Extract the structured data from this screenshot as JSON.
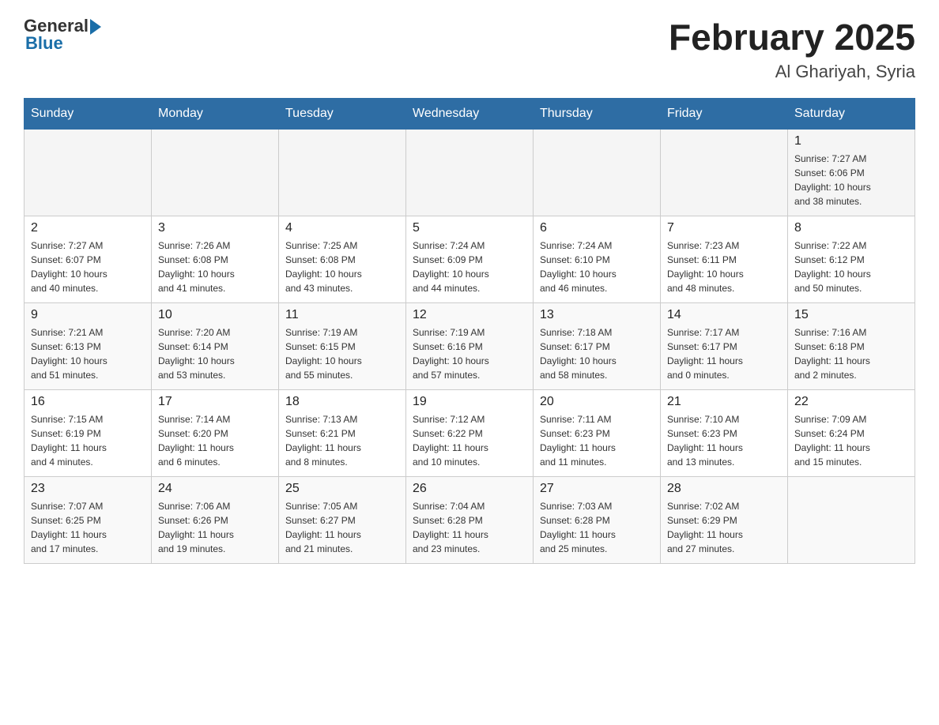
{
  "header": {
    "logo_general": "General",
    "logo_blue": "Blue",
    "title": "February 2025",
    "subtitle": "Al Ghariyah, Syria"
  },
  "weekdays": [
    "Sunday",
    "Monday",
    "Tuesday",
    "Wednesday",
    "Thursday",
    "Friday",
    "Saturday"
  ],
  "weeks": [
    [
      {
        "day": "",
        "info": ""
      },
      {
        "day": "",
        "info": ""
      },
      {
        "day": "",
        "info": ""
      },
      {
        "day": "",
        "info": ""
      },
      {
        "day": "",
        "info": ""
      },
      {
        "day": "",
        "info": ""
      },
      {
        "day": "1",
        "info": "Sunrise: 7:27 AM\nSunset: 6:06 PM\nDaylight: 10 hours\nand 38 minutes."
      }
    ],
    [
      {
        "day": "2",
        "info": "Sunrise: 7:27 AM\nSunset: 6:07 PM\nDaylight: 10 hours\nand 40 minutes."
      },
      {
        "day": "3",
        "info": "Sunrise: 7:26 AM\nSunset: 6:08 PM\nDaylight: 10 hours\nand 41 minutes."
      },
      {
        "day": "4",
        "info": "Sunrise: 7:25 AM\nSunset: 6:08 PM\nDaylight: 10 hours\nand 43 minutes."
      },
      {
        "day": "5",
        "info": "Sunrise: 7:24 AM\nSunset: 6:09 PM\nDaylight: 10 hours\nand 44 minutes."
      },
      {
        "day": "6",
        "info": "Sunrise: 7:24 AM\nSunset: 6:10 PM\nDaylight: 10 hours\nand 46 minutes."
      },
      {
        "day": "7",
        "info": "Sunrise: 7:23 AM\nSunset: 6:11 PM\nDaylight: 10 hours\nand 48 minutes."
      },
      {
        "day": "8",
        "info": "Sunrise: 7:22 AM\nSunset: 6:12 PM\nDaylight: 10 hours\nand 50 minutes."
      }
    ],
    [
      {
        "day": "9",
        "info": "Sunrise: 7:21 AM\nSunset: 6:13 PM\nDaylight: 10 hours\nand 51 minutes."
      },
      {
        "day": "10",
        "info": "Sunrise: 7:20 AM\nSunset: 6:14 PM\nDaylight: 10 hours\nand 53 minutes."
      },
      {
        "day": "11",
        "info": "Sunrise: 7:19 AM\nSunset: 6:15 PM\nDaylight: 10 hours\nand 55 minutes."
      },
      {
        "day": "12",
        "info": "Sunrise: 7:19 AM\nSunset: 6:16 PM\nDaylight: 10 hours\nand 57 minutes."
      },
      {
        "day": "13",
        "info": "Sunrise: 7:18 AM\nSunset: 6:17 PM\nDaylight: 10 hours\nand 58 minutes."
      },
      {
        "day": "14",
        "info": "Sunrise: 7:17 AM\nSunset: 6:17 PM\nDaylight: 11 hours\nand 0 minutes."
      },
      {
        "day": "15",
        "info": "Sunrise: 7:16 AM\nSunset: 6:18 PM\nDaylight: 11 hours\nand 2 minutes."
      }
    ],
    [
      {
        "day": "16",
        "info": "Sunrise: 7:15 AM\nSunset: 6:19 PM\nDaylight: 11 hours\nand 4 minutes."
      },
      {
        "day": "17",
        "info": "Sunrise: 7:14 AM\nSunset: 6:20 PM\nDaylight: 11 hours\nand 6 minutes."
      },
      {
        "day": "18",
        "info": "Sunrise: 7:13 AM\nSunset: 6:21 PM\nDaylight: 11 hours\nand 8 minutes."
      },
      {
        "day": "19",
        "info": "Sunrise: 7:12 AM\nSunset: 6:22 PM\nDaylight: 11 hours\nand 10 minutes."
      },
      {
        "day": "20",
        "info": "Sunrise: 7:11 AM\nSunset: 6:23 PM\nDaylight: 11 hours\nand 11 minutes."
      },
      {
        "day": "21",
        "info": "Sunrise: 7:10 AM\nSunset: 6:23 PM\nDaylight: 11 hours\nand 13 minutes."
      },
      {
        "day": "22",
        "info": "Sunrise: 7:09 AM\nSunset: 6:24 PM\nDaylight: 11 hours\nand 15 minutes."
      }
    ],
    [
      {
        "day": "23",
        "info": "Sunrise: 7:07 AM\nSunset: 6:25 PM\nDaylight: 11 hours\nand 17 minutes."
      },
      {
        "day": "24",
        "info": "Sunrise: 7:06 AM\nSunset: 6:26 PM\nDaylight: 11 hours\nand 19 minutes."
      },
      {
        "day": "25",
        "info": "Sunrise: 7:05 AM\nSunset: 6:27 PM\nDaylight: 11 hours\nand 21 minutes."
      },
      {
        "day": "26",
        "info": "Sunrise: 7:04 AM\nSunset: 6:28 PM\nDaylight: 11 hours\nand 23 minutes."
      },
      {
        "day": "27",
        "info": "Sunrise: 7:03 AM\nSunset: 6:28 PM\nDaylight: 11 hours\nand 25 minutes."
      },
      {
        "day": "28",
        "info": "Sunrise: 7:02 AM\nSunset: 6:29 PM\nDaylight: 11 hours\nand 27 minutes."
      },
      {
        "day": "",
        "info": ""
      }
    ]
  ]
}
